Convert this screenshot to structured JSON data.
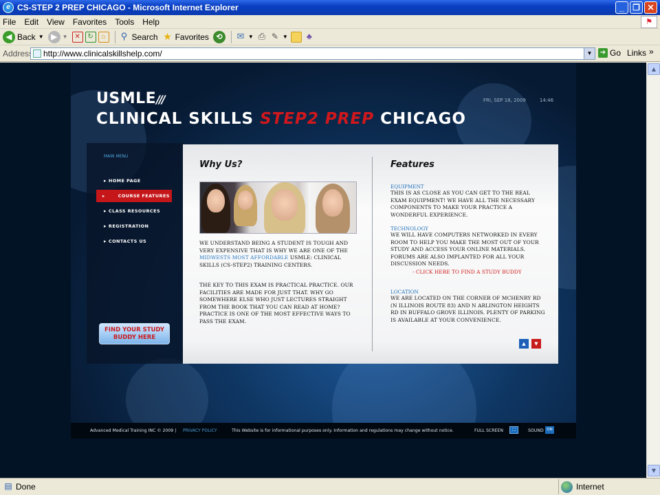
{
  "window": {
    "title": "CS-STEP 2 PREP CHICAGO - Microsoft Internet Explorer",
    "minimize": "_",
    "maximize": "❐",
    "close": "✕"
  },
  "menubar": [
    "File",
    "Edit",
    "View",
    "Favorites",
    "Tools",
    "Help"
  ],
  "toolbar": {
    "back": "Back",
    "search": "Search",
    "favorites": "Favorites"
  },
  "address": {
    "label": "Address",
    "url": "http://www.clinicalskillshelp.com/",
    "go": "Go",
    "links": "Links"
  },
  "site": {
    "logo_line1": "USMLE",
    "logo_line2_white1": "CLINICAL SKILLS",
    "logo_line2_red": "STEP2 PREP",
    "logo_line2_white2": "CHICAGO",
    "date": "FRI, SEP 18, 2009",
    "time": "14:46",
    "menu_title": "MAIN MENU",
    "menu": [
      "HOME PAGE",
      "COURSE FEATURES",
      "CLASS RESOURCES",
      "REGISTRATION",
      "CONTACTS US"
    ],
    "menu_active_index": 1,
    "study_button": "FIND YOUR STUDY BUDDY HERE",
    "why_heading": "Why Us?",
    "features_heading": "Features",
    "why_p1_a": "We understand being a student is tough and very expensive that is why we are one of the",
    "why_p1_link": "Midwests most affordable",
    "why_p1_b": "USMLE: Clinical Skills (CS-Step2) training centers.",
    "why_p2": "The key to this exam is practical practice. Our facilities are made for just that. Why go somewhere else who just lectures straight from the book that you can read at home? Practice is one of the most effective ways to pass the exam.",
    "features": [
      {
        "title": "Equipment",
        "text": "This is as close as you can get to the real exam equipment! We have all the necessary components to make your practice a wonderful experience."
      },
      {
        "title": "Technology",
        "text": "We will have computers networked in every room to help you make the most out of your study and access your online materials. Forums are also implanted for all your discussion needs."
      },
      {
        "title": "Location",
        "text": "We are located on the corner of McHenry Rd (N Illinois Route 83) and N Arlington Heights Rd in Buffalo Grove Illinois. Plenty of parking is available at your convenience."
      }
    ],
    "click_here": "- Click Here to find a study buddy",
    "footer_copy": "Advanced Medical Training INC © 2009 |",
    "footer_privacy": "PRIVACY POLICY",
    "footer_disclaimer": "This Website is for informational purposes only. Information and regulations may change without notice.",
    "footer_fullscreen": "FULL SCREEN",
    "footer_sound": "SOUND",
    "footer_on": "ON"
  },
  "status": {
    "text": "Done",
    "zone": "Internet"
  }
}
